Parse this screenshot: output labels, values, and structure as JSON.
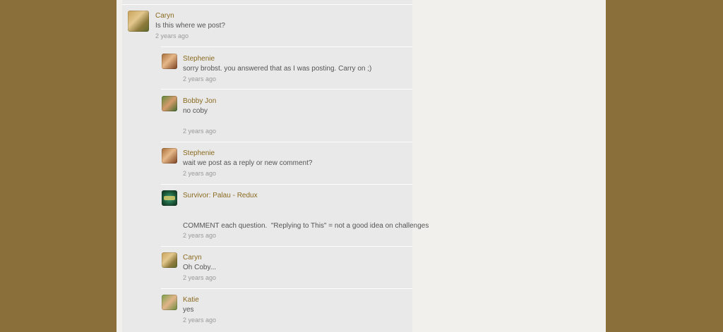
{
  "comments": [
    {
      "author": "Caryn",
      "text": "Is this where we post?",
      "time": "2 years ago",
      "avatar_icon": "caryn-avatar-icon"
    },
    {
      "author": "Stephenie",
      "text": "sorry brobst. you answered that as I was posting. Carry on ;)",
      "time": "2 years ago",
      "avatar_icon": "stephenie-avatar-icon"
    },
    {
      "author": "Bobby Jon",
      "text": "no coby",
      "time": "2 years ago",
      "avatar_icon": "bobby-jon-avatar-icon"
    },
    {
      "author": "Stephenie",
      "text": "wait we post as a reply or new comment?",
      "time": "2 years ago",
      "avatar_icon": "stephenie-avatar-icon"
    },
    {
      "author": "Survivor: Palau - Redux",
      "text": "COMMENT each question.  \"Replying to This\" = not a good idea on challenges",
      "time": "2 years ago",
      "avatar_icon": "survivor-logo-icon"
    },
    {
      "author": "Caryn",
      "text": "Oh Coby...",
      "time": "2 years ago",
      "avatar_icon": "caryn-avatar-icon"
    },
    {
      "author": "Katie",
      "text": "yes",
      "time": "2 years ago",
      "avatar_icon": "katie-avatar-icon"
    }
  ],
  "colors": {
    "outer_background": "#8a6f3a",
    "page_background": "#f1f0ec",
    "thread_background": "#e9e9e9",
    "author_link": "#8a6a1f",
    "body_text": "#555555",
    "timestamp": "#9a9a9a"
  }
}
